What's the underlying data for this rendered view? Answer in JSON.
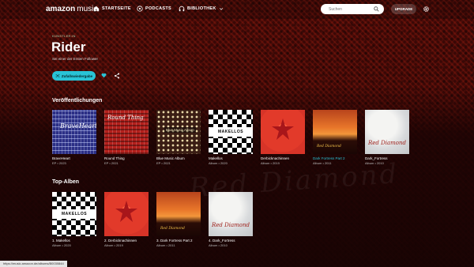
{
  "nav": {
    "logo_amazon": "amazon",
    "logo_music": "music",
    "home": "STARTSEITE",
    "podcasts": "PODCASTS",
    "library": "BIBLIOTHEK",
    "search_placeholder": "Suchen",
    "upgrade": "UPGRADE"
  },
  "header": {
    "eyebrow": "KÜNSTLER:IN",
    "title": "Rider",
    "subtitle": "Sei einer der Ersten Follower",
    "shuffle_label": "Zufallswiedergabe"
  },
  "colors": {
    "accent": "#29c3d6"
  },
  "sections": {
    "releases_title": "Veröffentlichungen",
    "top_title": "Top-Alben"
  },
  "releases": [
    {
      "title": "BraveHeart",
      "meta": "EP • 2023",
      "art_text": "BraveHeart"
    },
    {
      "title": "Round Thing",
      "meta": "EP • 2021",
      "art_text": "Round Thing"
    },
    {
      "title": "Blue Music Album",
      "meta": "EP • 2021",
      "art_text": "Blue Music Album"
    },
    {
      "title": "Makellos",
      "meta": "Album • 2020",
      "art_text": "MAKELLOS"
    },
    {
      "title": "Derbicknachinnen",
      "meta": "Album • 2019",
      "art_text": ""
    },
    {
      "title": "Dark Fortress Part 2",
      "meta": "Album • 2011",
      "art_text": "Red Diamond"
    },
    {
      "title": "Dark_Fortress",
      "meta": "Album • 2010",
      "art_text": "Red Diamond"
    }
  ],
  "top_albums": [
    {
      "title": "1. Makellos",
      "meta": "Album • 2020",
      "art_text": "MAKELLOS"
    },
    {
      "title": "2. Derbicknachinnen",
      "meta": "Album • 2019",
      "art_text": ""
    },
    {
      "title": "3. Dark Fortress Part 2",
      "meta": "Album • 2011",
      "art_text": "Red Diamond"
    },
    {
      "title": "4. Dark_Fortress",
      "meta": "Album • 2010",
      "art_text": "Red Diamond"
    }
  ],
  "background_text": "Red Diamond",
  "status_url": "https://music.amazon.de/albums/B0030844"
}
